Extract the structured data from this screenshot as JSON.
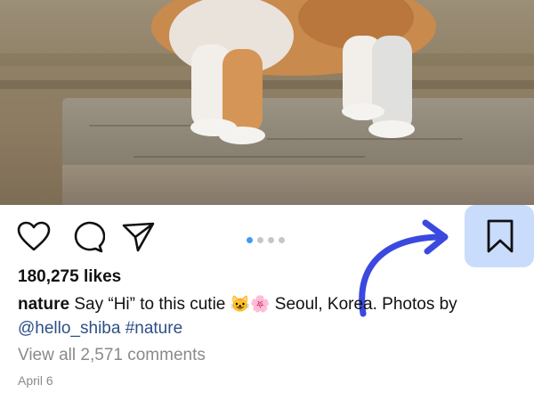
{
  "post": {
    "image_alt": "Shiba puppy standing on a wooden bench",
    "likes": "180,275 likes",
    "caption": {
      "username": "nature",
      "text_before": "Say “Hi” to this cutie",
      "emoji_1": "😺",
      "emoji_2": "🌸",
      "text_after": "Seoul, Korea. Photos by",
      "mention": "@hello_shiba",
      "hashtag": "#nature"
    },
    "comments_link": "View all 2,571 comments",
    "date": "April 6"
  },
  "actions": {
    "like_icon": "heart-icon",
    "comment_icon": "comment-icon",
    "share_icon": "send-icon",
    "save_icon": "bookmark-icon"
  },
  "carousel": {
    "total": 4,
    "active_index": 0
  },
  "colors": {
    "accent_dot": "#3f9bf4",
    "save_highlight": "#c9dcfb",
    "arrow": "#3b49df",
    "link": "#2d4f87"
  }
}
